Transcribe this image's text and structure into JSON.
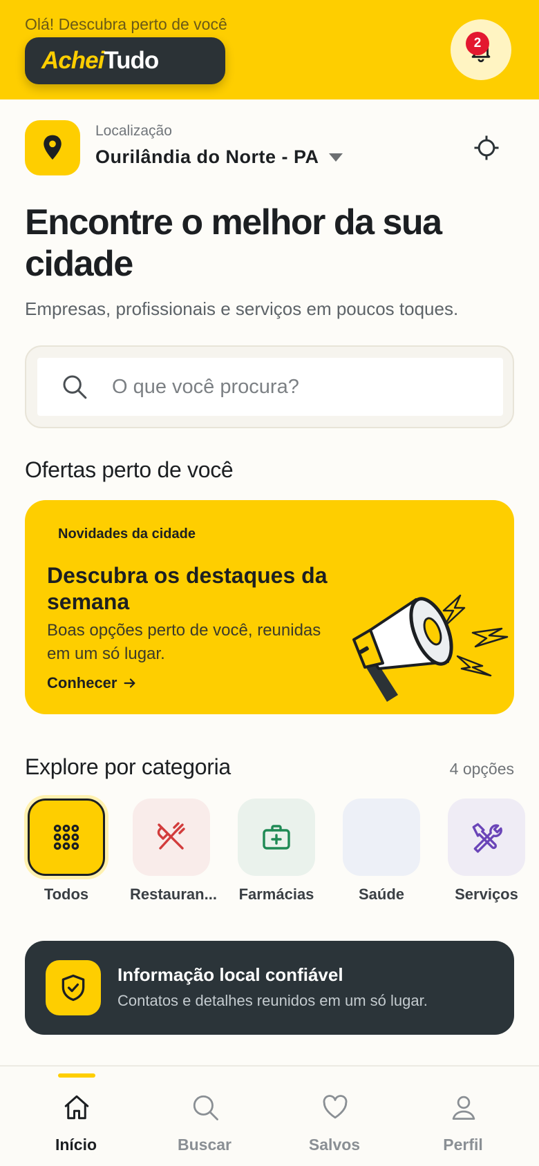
{
  "header": {
    "greeting": "Olá! Descubra perto de você",
    "brand_part1": "Achei",
    "brand_part2": "Tudo",
    "notification_count": "2"
  },
  "location": {
    "label": "Localização",
    "city": "Ourilândia do Norte - PA"
  },
  "hero": {
    "title": "Encontre o melhor da sua cidade",
    "subtitle": "Empresas, profissionais e serviços em poucos toques."
  },
  "search": {
    "placeholder": "O que você procura?",
    "value": ""
  },
  "offers": {
    "section_title": "Ofertas perto de você",
    "tag": "Novidades da cidade",
    "title": "Descubra os destaques da semana",
    "text": "Boas opções perto de você, reunidas em um só lugar.",
    "cta": "Conhecer"
  },
  "categories": {
    "section_title": "Explore por categoria",
    "count": "4 opções",
    "items": [
      {
        "label": "Todos",
        "icon": "grid-icon",
        "bg": "#fece00"
      },
      {
        "label": "Restauran...",
        "icon": "fork-knife-icon",
        "bg": "#f9ecea"
      },
      {
        "label": "Farmácias",
        "icon": "first-aid-kit-icon",
        "bg": "#eaf2ec"
      },
      {
        "label": "Saúde",
        "icon": "",
        "bg": "#edf0f7"
      },
      {
        "label": "Serviços",
        "icon": "tools-icon",
        "bg": "#efecf5"
      }
    ]
  },
  "trust": {
    "title": "Informação local confiável",
    "text": "Contatos e detalhes reunidos em um só lugar."
  },
  "nav": {
    "items": [
      {
        "label": "Início",
        "icon": "home-icon",
        "active": true
      },
      {
        "label": "Buscar",
        "icon": "search-icon",
        "active": false
      },
      {
        "label": "Salvos",
        "icon": "heart-icon",
        "active": false
      },
      {
        "label": "Perfil",
        "icon": "user-icon",
        "active": false
      }
    ]
  },
  "colors": {
    "brand_yellow": "#fece00",
    "dark": "#2b3236",
    "badge_red": "#e3182f"
  }
}
